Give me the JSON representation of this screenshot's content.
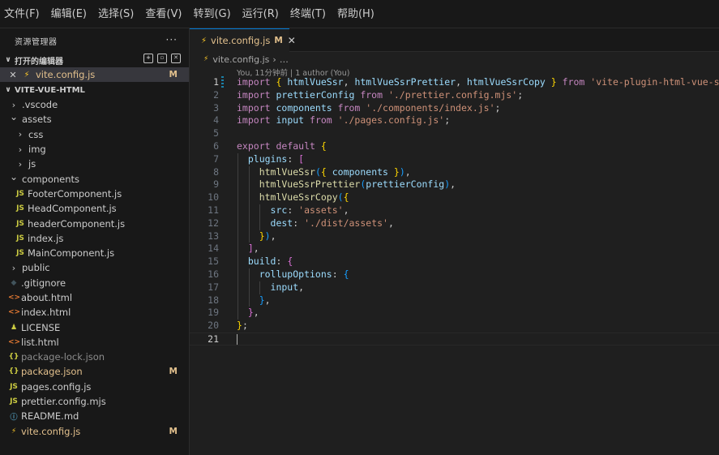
{
  "menu": [
    "文件(F)",
    "编辑(E)",
    "选择(S)",
    "查看(V)",
    "转到(G)",
    "运行(R)",
    "终端(T)",
    "帮助(H)"
  ],
  "explorer": {
    "title": "资源管理器",
    "more": "···",
    "open_editors_label": "打开的编辑器",
    "open_editor": {
      "name": "vite.config.js",
      "badge": "M"
    },
    "project_label": "VITE-VUE-HTML",
    "tree": [
      {
        "name": ".vscode",
        "kind": "folder",
        "state": "collapsed",
        "depth": 1
      },
      {
        "name": "assets",
        "kind": "folder",
        "state": "expanded",
        "depth": 1
      },
      {
        "name": "css",
        "kind": "folder",
        "state": "collapsed",
        "depth": 2
      },
      {
        "name": "img",
        "kind": "folder",
        "state": "collapsed",
        "depth": 2
      },
      {
        "name": "js",
        "kind": "folder",
        "state": "collapsed",
        "depth": 2
      },
      {
        "name": "components",
        "kind": "folder",
        "state": "expanded",
        "depth": 1
      },
      {
        "name": "FooterComponent.js",
        "kind": "js",
        "depth": 2
      },
      {
        "name": "HeadComponent.js",
        "kind": "js",
        "depth": 2
      },
      {
        "name": "headerComponent.js",
        "kind": "js",
        "depth": 2
      },
      {
        "name": "index.js",
        "kind": "js",
        "depth": 2
      },
      {
        "name": "MainComponent.js",
        "kind": "js",
        "depth": 2
      },
      {
        "name": "public",
        "kind": "folder",
        "state": "collapsed",
        "depth": 1
      },
      {
        "name": ".gitignore",
        "kind": "git",
        "depth": 1
      },
      {
        "name": "about.html",
        "kind": "html",
        "depth": 1
      },
      {
        "name": "index.html",
        "kind": "html",
        "depth": 1
      },
      {
        "name": "LICENSE",
        "kind": "license",
        "depth": 1
      },
      {
        "name": "list.html",
        "kind": "html",
        "depth": 1
      },
      {
        "name": "package-lock.json",
        "kind": "json",
        "depth": 1,
        "dim": true
      },
      {
        "name": "package.json",
        "kind": "json",
        "depth": 1,
        "modified": true,
        "badge": "M"
      },
      {
        "name": "pages.config.js",
        "kind": "js",
        "depth": 1
      },
      {
        "name": "prettier.config.mjs",
        "kind": "js",
        "depth": 1
      },
      {
        "name": "README.md",
        "kind": "info",
        "depth": 1
      },
      {
        "name": "vite.config.js",
        "kind": "vite",
        "depth": 1,
        "modified": true,
        "badge": "M"
      }
    ]
  },
  "editor": {
    "tab": {
      "name": "vite.config.js",
      "badge": "M",
      "close": "✕"
    },
    "breadcrumb": {
      "file": "vite.config.js",
      "rest": "…"
    },
    "codelens": "You, 11分钟前 | 1 author (You)",
    "lines": [
      [
        [
          "import ",
          "k-import"
        ],
        [
          "{ ",
          "k-br1"
        ],
        [
          "htmlVueSsr",
          "k-var"
        ],
        [
          ", ",
          "k-p"
        ],
        [
          "htmlVueSsrPrettier",
          "k-var"
        ],
        [
          ", ",
          "k-p"
        ],
        [
          "htmlVueSsrCopy",
          "k-var"
        ],
        [
          " }",
          "k-br1"
        ],
        [
          " from ",
          "k-import"
        ],
        [
          "'vite-plugin-html-vue-ssr'",
          "k-str"
        ],
        [
          ";",
          "k-p"
        ]
      ],
      [
        [
          "import ",
          "k-import"
        ],
        [
          "prettierConfig",
          "k-var"
        ],
        [
          " from ",
          "k-import"
        ],
        [
          "'./prettier.config.mjs'",
          "k-str"
        ],
        [
          ";",
          "k-p"
        ]
      ],
      [
        [
          "import ",
          "k-import"
        ],
        [
          "components",
          "k-var"
        ],
        [
          " from ",
          "k-import"
        ],
        [
          "'./components/index.js'",
          "k-str"
        ],
        [
          ";",
          "k-p"
        ]
      ],
      [
        [
          "import ",
          "k-import"
        ],
        [
          "input",
          "k-var"
        ],
        [
          " from ",
          "k-import"
        ],
        [
          "'./pages.config.js'",
          "k-str"
        ],
        [
          ";",
          "k-p"
        ]
      ],
      [],
      [
        [
          "export ",
          "k-import"
        ],
        [
          "default ",
          "k-import"
        ],
        [
          "{",
          "k-br1"
        ]
      ],
      [
        [
          "  plugins",
          "k-var"
        ],
        [
          ": ",
          "k-p"
        ],
        [
          "[",
          "k-br2"
        ]
      ],
      [
        [
          "    htmlVueSsr",
          "k-fn"
        ],
        [
          "(",
          "k-br3"
        ],
        [
          "{ ",
          "k-br1"
        ],
        [
          "components",
          "k-var"
        ],
        [
          " }",
          "k-br1"
        ],
        [
          ")",
          "k-br3"
        ],
        [
          ",",
          "k-p"
        ]
      ],
      [
        [
          "    htmlVueSsrPrettier",
          "k-fn"
        ],
        [
          "(",
          "k-br3"
        ],
        [
          "prettierConfig",
          "k-var"
        ],
        [
          ")",
          "k-br3"
        ],
        [
          ",",
          "k-p"
        ]
      ],
      [
        [
          "    htmlVueSsrCopy",
          "k-fn"
        ],
        [
          "(",
          "k-br3"
        ],
        [
          "{",
          "k-br1"
        ]
      ],
      [
        [
          "      src",
          "k-var"
        ],
        [
          ": ",
          "k-p"
        ],
        [
          "'assets'",
          "k-str"
        ],
        [
          ",",
          "k-p"
        ]
      ],
      [
        [
          "      dest",
          "k-var"
        ],
        [
          ": ",
          "k-p"
        ],
        [
          "'./dist/assets'",
          "k-str"
        ],
        [
          ",",
          "k-p"
        ]
      ],
      [
        [
          "    }",
          "k-br1"
        ],
        [
          ")",
          "k-br3"
        ],
        [
          ",",
          "k-p"
        ]
      ],
      [
        [
          "  ]",
          "k-br2"
        ],
        [
          ",",
          "k-p"
        ]
      ],
      [
        [
          "  build",
          "k-var"
        ],
        [
          ": ",
          "k-p"
        ],
        [
          "{",
          "k-br2"
        ]
      ],
      [
        [
          "    rollupOptions",
          "k-var"
        ],
        [
          ": ",
          "k-p"
        ],
        [
          "{",
          "k-br3"
        ]
      ],
      [
        [
          "      input",
          "k-var"
        ],
        [
          ",",
          "k-p"
        ]
      ],
      [
        [
          "    }",
          "k-br3"
        ],
        [
          ",",
          "k-p"
        ]
      ],
      [
        [
          "  }",
          "k-br2"
        ],
        [
          ",",
          "k-p"
        ]
      ],
      [
        [
          "}",
          "k-br1"
        ],
        [
          ";",
          "k-p"
        ]
      ],
      []
    ]
  }
}
